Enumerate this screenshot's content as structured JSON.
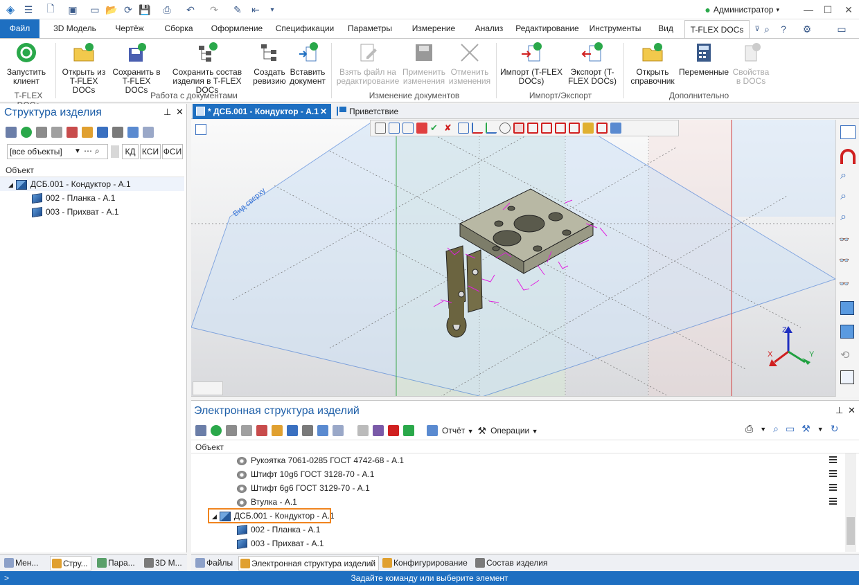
{
  "app": {
    "user": "Администратор",
    "colors": {
      "accent": "#1e6fc1",
      "highlight_box": "#f0841e",
      "magenta_constraints": "#e020e0"
    }
  },
  "ribbon_tabs": [
    "Файл",
    "3D Модель",
    "Чертёж",
    "Сборка",
    "Оформление",
    "Спецификации",
    "Параметры",
    "Измерение",
    "Анализ",
    "Редактирование",
    "Инструменты",
    "Вид",
    "T-FLEX DOCs"
  ],
  "ribbon": {
    "buttons": {
      "start_client": "Запустить клиент",
      "open_from": "Открыть из T-FLEX DOCs",
      "save_to": "Сохранить в T-FLEX DOCs",
      "save_struct": "Сохранить состав изделия в T-FLEX DOCs",
      "create_rev": "Создать ревизию",
      "insert_doc": "Вставить документ",
      "take_file": "Взять файл на редактирование",
      "apply_changes": "Применить изменения",
      "cancel_changes": "Отменить изменения",
      "import": "Импорт (T-FLEX DOCs)",
      "export": "Экспорт (T-FLEX DOCs)",
      "open_ref": "Открыть справочник",
      "variables": "Переменные",
      "props_docs": "Свойства в DOCs"
    },
    "groups": {
      "tflex_docs": "T-FLEX DOCs",
      "work_docs": "Работа с документами",
      "change_docs": "Изменение документов",
      "import_export": "Импорт/Экспорт",
      "additional": "Дополнительно"
    }
  },
  "left_panel": {
    "title": "Структура изделия",
    "filter_value": "[все объекты]",
    "chips": [
      "КД",
      "КСИ",
      "ФСИ"
    ],
    "column": "Объект",
    "tree": [
      {
        "label": "ДСБ.001 - Кондуктор - А.1"
      },
      {
        "label": "002 - Планка - А.1"
      },
      {
        "label": "003 - Прихват - А.1"
      }
    ]
  },
  "doc_tabs": {
    "active": "* ДСБ.001 - Кондуктор - А.1",
    "second": "Приветствие"
  },
  "viewport": {
    "view_label": "Вид сверху",
    "axes": {
      "z": "Z",
      "x": "X",
      "y": "Y"
    }
  },
  "bottom_panel": {
    "title": "Электронная структура изделий",
    "report_label": "Отчёт",
    "operations_label": "Операции",
    "column": "Объект",
    "rows": [
      {
        "label": "Рукоятка 7061-0285 ГОСТ 4742-68 - А.1"
      },
      {
        "label": "Штифт 10g6 ГОСТ 3128-70 - А.1"
      },
      {
        "label": "Штифт 6g6 ГОСТ 3129-70 - А.1"
      },
      {
        "label": "Втулка  - А.1"
      },
      {
        "label": "ДСБ.001 - Кондуктор - А.1"
      },
      {
        "label": "002 - Планка - А.1"
      },
      {
        "label": "003 - Прихват - А.1"
      }
    ]
  },
  "left_bottom_tabs": [
    "Мен...",
    "Стру...",
    "Пара...",
    "3D М..."
  ],
  "right_bottom_tabs": [
    "Файлы",
    "Электронная структура изделий",
    "Конфигурирование",
    "Состав изделия"
  ],
  "status": {
    "prompt": ">",
    "message": "Задайте команду или выберите элемент"
  }
}
